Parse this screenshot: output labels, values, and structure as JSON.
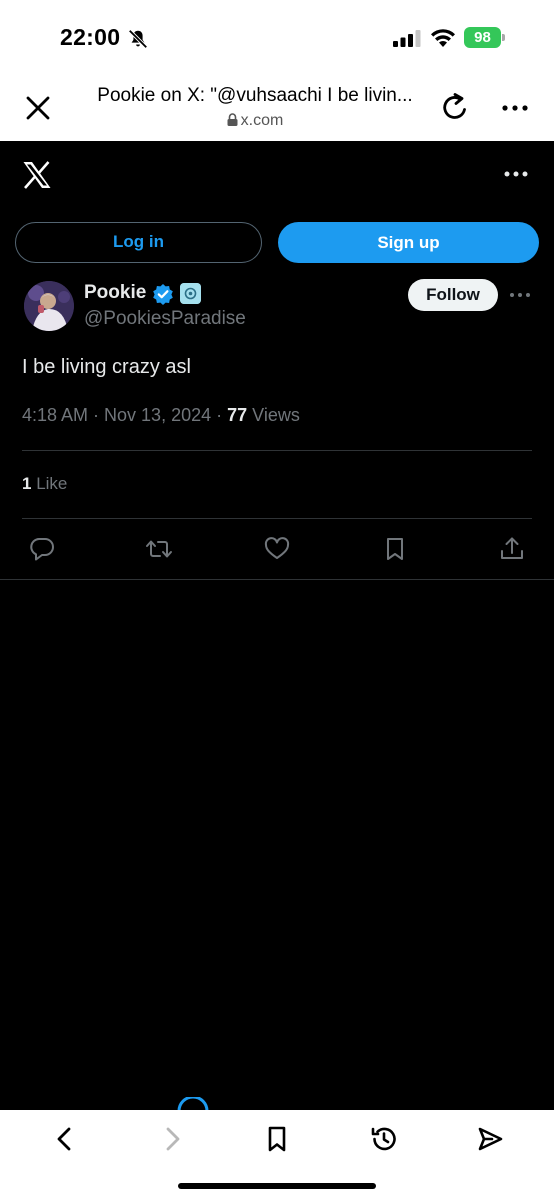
{
  "status_bar": {
    "time": "22:00",
    "battery": "98"
  },
  "browser": {
    "page_title": "Pookie on X: \"@vuhsaachi I be livin...",
    "url": "x.com"
  },
  "auth": {
    "login_label": "Log in",
    "signup_label": "Sign up"
  },
  "tweet": {
    "display_name": "Pookie",
    "handle": "@PookiesParadise",
    "follow_label": "Follow",
    "text": "I be living crazy asl",
    "timestamp": "4:18 AM · Nov 13, 2024 · ",
    "views_count": "77",
    "views_label": " Views",
    "likes_count": "1",
    "likes_label": " Like"
  },
  "colors": {
    "accent": "#1d9bf0",
    "background": "#000000",
    "text_primary": "#e7e9ea",
    "text_secondary": "#71767b",
    "battery_green": "#34c759"
  },
  "icons": {
    "status": [
      "bell-off-icon",
      "signal-icon",
      "wifi-icon",
      "battery-icon"
    ],
    "browser_top": [
      "close-icon",
      "lock-icon",
      "reload-icon",
      "more-icon"
    ],
    "tweet_actions": [
      "reply-icon",
      "retweet-icon",
      "like-icon",
      "bookmark-icon",
      "share-icon"
    ],
    "browser_bottom": [
      "back-icon",
      "forward-icon",
      "bookmark-icon",
      "history-icon",
      "send-icon"
    ]
  }
}
